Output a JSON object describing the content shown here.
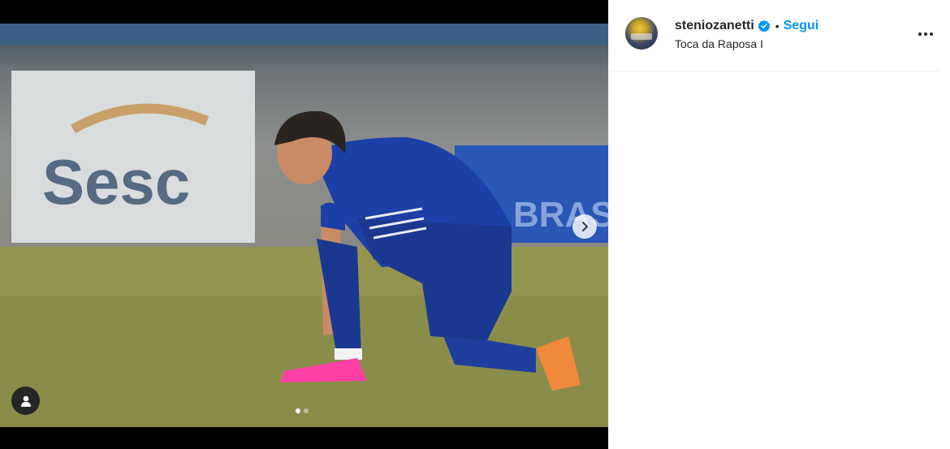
{
  "post": {
    "username": "steniozanetti",
    "verified": true,
    "separator": "•",
    "follow_label": "Segui",
    "location": "Toca da Raposa I"
  },
  "media": {
    "slide_count": 2,
    "active_slide": 1,
    "banner_left_text": "Sesc",
    "banner_right_text": "BRAS"
  },
  "icons": {
    "verified": "verified-badge-icon",
    "more": "more-options-icon",
    "next": "chevron-right-icon",
    "tag": "user-tag-icon"
  },
  "colors": {
    "accent": "#0095f6",
    "text": "#262626",
    "jersey": "#1c3fa8",
    "boots": "#ff3fa4"
  }
}
